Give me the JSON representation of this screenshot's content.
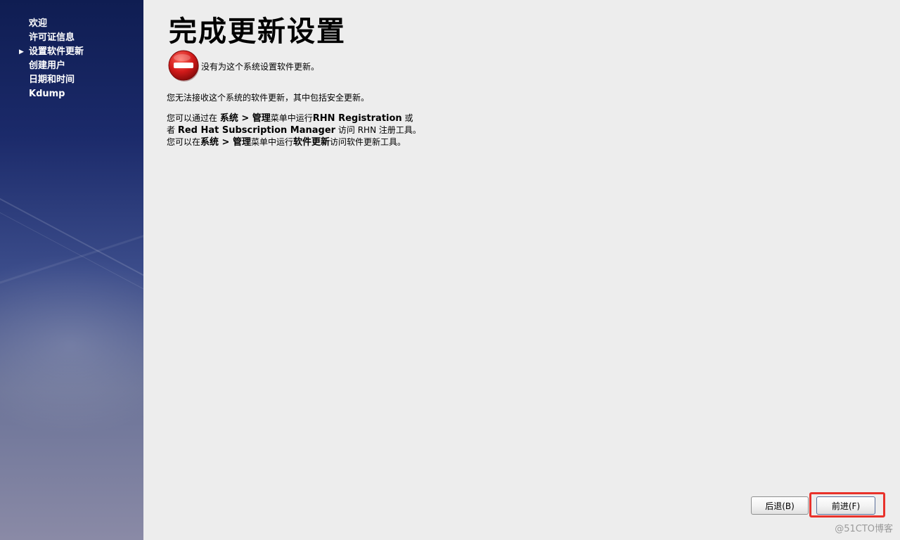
{
  "sidebar": {
    "items": [
      {
        "label": "欢迎",
        "current": false
      },
      {
        "label": "许可证信息",
        "current": false
      },
      {
        "label": "设置软件更新",
        "current": true
      },
      {
        "label": "创建用户",
        "current": false
      },
      {
        "label": "日期和时间",
        "current": false
      },
      {
        "label": "Kdump",
        "current": false
      }
    ]
  },
  "main": {
    "title": "完成更新设置",
    "notice_text": "没有为这个系统设置软件更新。",
    "para1": "您无法接收这个系统的软件更新，其中包括安全更新。",
    "para2": {
      "l1_a": "您可以通过在 ",
      "l1_b": "系统 > 管理",
      "l1_c": "菜单中运行",
      "l1_d": "RHN Registration",
      "l1_e": " 或",
      "l2_a": "者 ",
      "l2_b": "Red Hat Subscription Manager",
      "l2_c": " 访问 RHN 注册工具。",
      "l3_a": "您可以在",
      "l3_b": "系统 > 管理",
      "l3_c": "菜单中运行",
      "l3_d": "软件更新",
      "l3_e": "访问软件更新工具。"
    }
  },
  "buttons": {
    "back": "后退(B)",
    "forward": "前进(F)"
  },
  "watermark": "@51CTO博客",
  "colors": {
    "highlight": "#e8322b",
    "stop_icon": "#d11a1a"
  }
}
